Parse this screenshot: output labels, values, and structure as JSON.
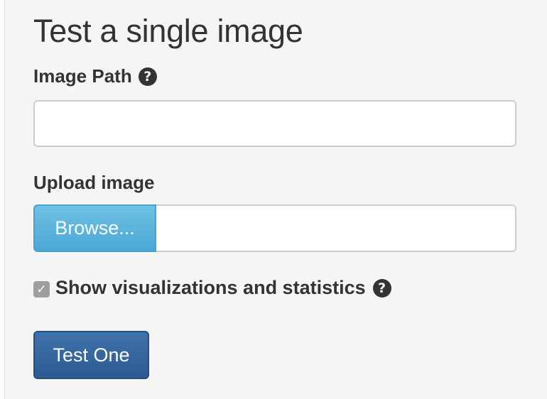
{
  "form": {
    "title": "Test a single image",
    "image_path": {
      "label": "Image Path",
      "value": "",
      "help_icon": "question-circle-icon"
    },
    "upload": {
      "label": "Upload image",
      "browse_label": "Browse...",
      "file_name": ""
    },
    "visualizations": {
      "label": "Show visualizations and statistics",
      "checked": true,
      "help_icon": "question-circle-icon"
    },
    "submit_label": "Test One"
  },
  "colors": {
    "panel_bg": "#f5f5f5",
    "browse_button": "#5bb8df",
    "submit_button": "#3567a0",
    "checkbox": "#9e9e9e"
  }
}
